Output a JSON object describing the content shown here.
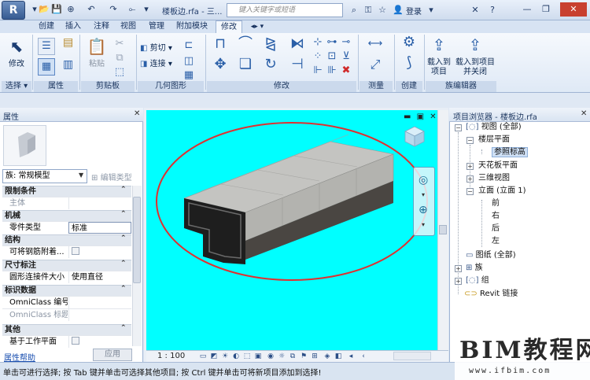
{
  "app": {
    "title": "楼板边.rfa - 三...",
    "search_placeholder": "键入关键字或短语",
    "login": "登录",
    "logo_letter": "R"
  },
  "tabs": [
    "创建",
    "插入",
    "注释",
    "视图",
    "管理",
    "附加模块",
    "修改"
  ],
  "active_tab": "修改",
  "ribbon": {
    "select": {
      "modify": "修改",
      "label": "选择 ▾"
    },
    "properties_label": "属性",
    "clipboard": {
      "paste": "粘贴",
      "label": "剪贴板"
    },
    "geometry": {
      "cut": "剪切",
      "join": "连接",
      "label": "几何图形"
    },
    "modify_label": "修改",
    "measure_label": "测量",
    "create_label": "创建",
    "family_editor": {
      "load_to_project": "载入到项目",
      "load_and_close": "载入到项目并关闭",
      "label": "族编辑器"
    }
  },
  "properties": {
    "title": "属性",
    "type_selector": "族: 常规模型",
    "edit_type": "编辑类型",
    "groups": [
      {
        "name": "限制条件",
        "rows": [
          {
            "key": "主体",
            "value": "",
            "dim": true
          }
        ]
      },
      {
        "name": "机械",
        "rows": [
          {
            "key": "零件类型",
            "value": "标准",
            "dim": false
          }
        ]
      },
      {
        "name": "结构",
        "rows": [
          {
            "key": "可将钢筋附着...",
            "value": "",
            "checkbox": true
          }
        ]
      },
      {
        "name": "尺寸标注",
        "rows": [
          {
            "key": "圆形连接件大小",
            "value": "使用直径",
            "dim": false
          }
        ]
      },
      {
        "name": "标识数据",
        "rows": [
          {
            "key": "OmniClass 编号",
            "value": "",
            "dim": false
          },
          {
            "key": "OmniClass 标题",
            "value": "",
            "dim": true
          }
        ]
      },
      {
        "name": "其他",
        "rows": [
          {
            "key": "基于工作平面",
            "value": "",
            "checkbox": true
          }
        ]
      }
    ],
    "help": "属性帮助",
    "apply": "应用"
  },
  "viewport": {
    "scale": "1 : 100",
    "background": "#00ffff",
    "highlight_color": "#e03030"
  },
  "browser": {
    "title": "项目浏览器 - 楼板边.rfa",
    "tree": {
      "views": "视图 (全部)",
      "floor_plans": "楼层平面",
      "ref_level": "参照标高",
      "ceiling_plans": "天花板平面",
      "view_3d": "三维视图",
      "elevations": "立面 (立面 1)",
      "front": "前",
      "right": "右",
      "back": "后",
      "left": "左",
      "sheets": "图纸 (全部)",
      "families": "族",
      "groups": "组",
      "revit_links": "Revit 链接"
    }
  },
  "status": {
    "text": "单击可进行选择; 按 Tab 键并单击可选择其他项目; 按 Ctrl 键并单击可将新项目添加到选择!"
  },
  "watermark": {
    "logo": "BIM教程网",
    "url": "www.ifbim.com"
  }
}
